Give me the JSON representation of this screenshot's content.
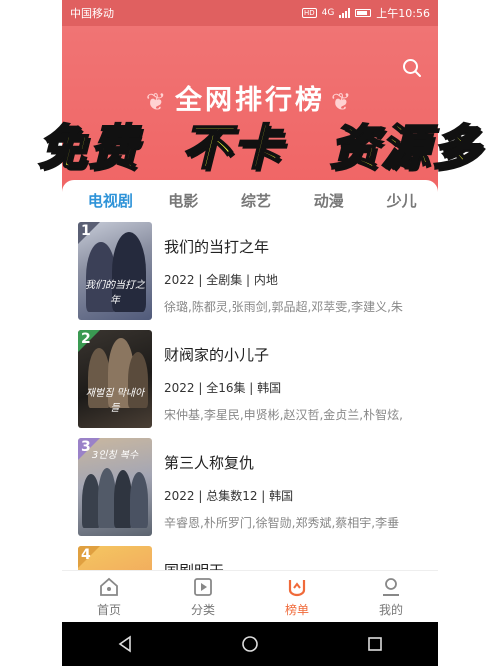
{
  "status_bar": {
    "carrier": "中国移动",
    "badge": "HD",
    "network": "4G",
    "time": "上午10:56"
  },
  "header": {
    "title": "全网排行榜"
  },
  "overlay": {
    "slogan_1": "免费",
    "slogan_2": "不卡",
    "slogan_3": "资源多"
  },
  "tabs": [
    {
      "label": "电视剧",
      "active": true
    },
    {
      "label": "电影"
    },
    {
      "label": "综艺"
    },
    {
      "label": "动漫"
    },
    {
      "label": "少儿"
    }
  ],
  "items": [
    {
      "rank": "1",
      "rank_color": "#5a5f74",
      "title": "我们的当打之年",
      "meta": "2022 | 全剧集 | 内地",
      "cast": "徐璐,陈都灵,张雨剑,郭品超,邓萃雯,李建义,朱",
      "poster_text": "我们的当打之年"
    },
    {
      "rank": "2",
      "rank_color": "#3a9a52",
      "title": "财阀家的小儿子",
      "meta": "2022 | 全16集 | 韩国",
      "cast": "宋仲基,李星民,申贤彬,赵汉哲,金贞兰,朴智炫,",
      "poster_text": "재벌집 막내아들"
    },
    {
      "rank": "3",
      "rank_color": "#9a82c8",
      "title": "第三人称复仇",
      "meta": "2022 | 总集数12 | 韩国",
      "cast": "辛睿恩,朴所罗门,徐智勋,郑秀斌,蔡相宇,李垂",
      "poster_text": "3인칭 복수"
    },
    {
      "rank": "4",
      "rank_color": "#e0a040",
      "title": "国剧明天",
      "meta": "",
      "cast": "",
      "poster_text": ""
    }
  ],
  "bottom_nav": [
    {
      "label": "首页",
      "icon": "home-icon"
    },
    {
      "label": "分类",
      "icon": "category-icon"
    },
    {
      "label": "榜单",
      "icon": "ranking-icon",
      "active": true
    },
    {
      "label": "我的",
      "icon": "profile-icon"
    }
  ],
  "colors": {
    "header": "#f06565",
    "active_tab": "#2e93d8",
    "active_nav": "#f06a3a",
    "slogan": "#f6ff3a"
  }
}
